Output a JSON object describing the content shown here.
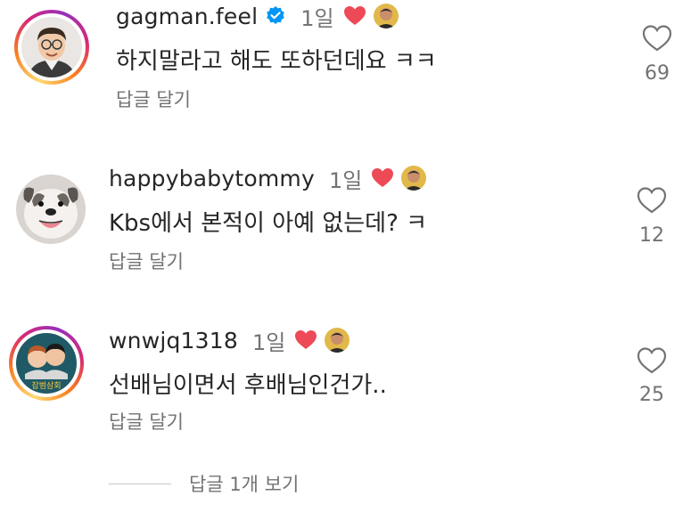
{
  "comments": [
    {
      "username": "gagman.feel",
      "verified": true,
      "time": "1일",
      "text": "하지말라고 해도 또하던데요 ㅋㅋ",
      "reply_label": "답글 달기",
      "likes": "69",
      "avatar_icon": "man-with-glasses-avatar",
      "story_ring": true
    },
    {
      "username": "happybabytommy",
      "verified": false,
      "time": "1일",
      "text": "Kbs에서 본적이 아예 없는데? ㅋ",
      "reply_label": "답글 달기",
      "likes": "12",
      "avatar_icon": "bulldog-avatar",
      "story_ring": false
    },
    {
      "username": "wnwjq1318",
      "verified": false,
      "time": "1일",
      "text": "선배님이면서 후배님인건가..",
      "reply_label": "답글 달기",
      "likes": "25",
      "avatar_icon": "two-men-logo-avatar",
      "avatar_caption": "잡범삼회",
      "story_ring": true
    }
  ],
  "view_replies": "답글 1개 보기",
  "colors": {
    "heart_red": "#ed4956",
    "verified_blue": "#0095f6",
    "muted_text": "#737373",
    "primary_text": "#262626"
  }
}
